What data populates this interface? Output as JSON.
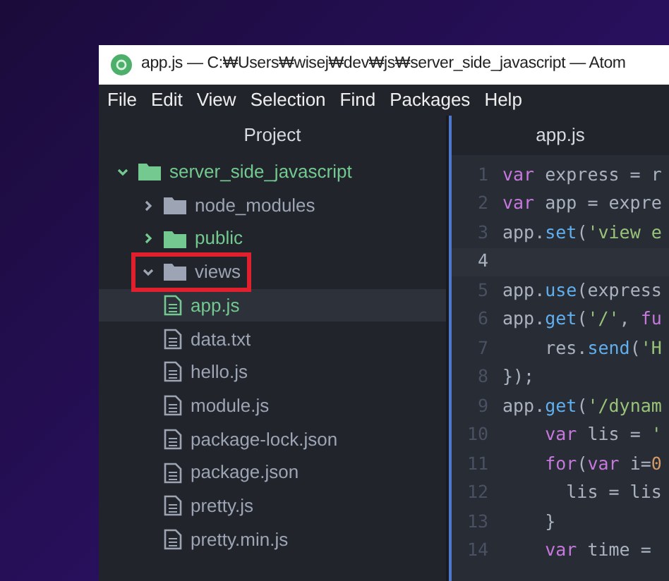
{
  "window": {
    "title": "app.js — C:₩Users₩wisej₩dev₩js₩server_side_javascript — Atom"
  },
  "menu": [
    "File",
    "Edit",
    "View",
    "Selection",
    "Find",
    "Packages",
    "Help"
  ],
  "tree_view": {
    "title": "Project",
    "items": [
      {
        "kind": "folder",
        "label": "server_side_javascript",
        "expanded": true,
        "color": "#73c990",
        "selected": false,
        "annotated": false,
        "children": [
          {
            "kind": "folder",
            "label": "node_modules",
            "expanded": false,
            "color": "#9da5b4",
            "selected": false,
            "annotated": false
          },
          {
            "kind": "folder",
            "label": "public",
            "expanded": false,
            "color": "#73c990",
            "selected": false,
            "annotated": false
          },
          {
            "kind": "folder",
            "label": "views",
            "expanded": true,
            "color": "#9da5b4",
            "selected": false,
            "annotated": true
          },
          {
            "kind": "file",
            "label": "app.js",
            "color": "#73c990",
            "selected": true,
            "annotated": false
          },
          {
            "kind": "file",
            "label": "data.txt",
            "color": "#9da5b4",
            "selected": false,
            "annotated": false
          },
          {
            "kind": "file",
            "label": "hello.js",
            "color": "#9da5b4",
            "selected": false,
            "annotated": false
          },
          {
            "kind": "file",
            "label": "module.js",
            "color": "#9da5b4",
            "selected": false,
            "annotated": false
          },
          {
            "kind": "file",
            "label": "package-lock.json",
            "color": "#9da5b4",
            "selected": false,
            "annotated": false
          },
          {
            "kind": "file",
            "label": "package.json",
            "color": "#9da5b4",
            "selected": false,
            "annotated": false
          },
          {
            "kind": "file",
            "label": "pretty.js",
            "color": "#9da5b4",
            "selected": false,
            "annotated": false
          },
          {
            "kind": "file",
            "label": "pretty.min.js",
            "color": "#9da5b4",
            "selected": false,
            "annotated": false
          }
        ]
      }
    ]
  },
  "editor": {
    "tab": "app.js",
    "lines": [
      {
        "number": "1",
        "current": false,
        "tokens": [
          {
            "kind": "keyword",
            "text": "var"
          },
          {
            "kind": "plain",
            "text": " express = r"
          }
        ]
      },
      {
        "number": "2",
        "current": false,
        "tokens": [
          {
            "kind": "keyword",
            "text": "var"
          },
          {
            "kind": "plain",
            "text": " app = expre"
          }
        ]
      },
      {
        "number": "3",
        "current": false,
        "tokens": [
          {
            "kind": "plain",
            "text": "app."
          },
          {
            "kind": "method",
            "text": "set"
          },
          {
            "kind": "plain",
            "text": "("
          },
          {
            "kind": "string",
            "text": "'view e"
          }
        ]
      },
      {
        "number": "4",
        "current": true
      },
      {
        "number": "5",
        "current": false,
        "tokens": [
          {
            "kind": "plain",
            "text": "app."
          },
          {
            "kind": "method",
            "text": "use"
          },
          {
            "kind": "plain",
            "text": "(express"
          }
        ]
      },
      {
        "number": "6",
        "current": false,
        "tokens": [
          {
            "kind": "plain",
            "text": "app."
          },
          {
            "kind": "method",
            "text": "get"
          },
          {
            "kind": "plain",
            "text": "("
          },
          {
            "kind": "string",
            "text": "'/'"
          },
          {
            "kind": "plain",
            "text": ", "
          },
          {
            "kind": "keyword",
            "text": "fu"
          }
        ]
      },
      {
        "number": "7",
        "current": false,
        "tokens": [
          {
            "kind": "plain",
            "text": "    res."
          },
          {
            "kind": "method",
            "text": "send"
          },
          {
            "kind": "plain",
            "text": "("
          },
          {
            "kind": "string",
            "text": "'H"
          }
        ]
      },
      {
        "number": "8",
        "current": false,
        "tokens": [
          {
            "kind": "plain",
            "text": "});"
          }
        ]
      },
      {
        "number": "9",
        "current": false,
        "tokens": [
          {
            "kind": "plain",
            "text": "app."
          },
          {
            "kind": "method",
            "text": "get"
          },
          {
            "kind": "plain",
            "text": "("
          },
          {
            "kind": "string",
            "text": "'/dynam"
          }
        ]
      },
      {
        "number": "10",
        "current": false,
        "tokens": [
          {
            "kind": "keyword",
            "text": "    var"
          },
          {
            "kind": "plain",
            "text": " lis = "
          },
          {
            "kind": "string",
            "text": "'"
          }
        ]
      },
      {
        "number": "11",
        "current": false,
        "tokens": [
          {
            "kind": "keyword",
            "text": "    for"
          },
          {
            "kind": "plain",
            "text": "("
          },
          {
            "kind": "keyword",
            "text": "var"
          },
          {
            "kind": "plain",
            "text": " i="
          },
          {
            "kind": "number",
            "text": "0"
          }
        ]
      },
      {
        "number": "12",
        "current": false,
        "tokens": [
          {
            "kind": "plain",
            "text": "      lis = lis"
          }
        ]
      },
      {
        "number": "13",
        "current": false,
        "tokens": [
          {
            "kind": "plain",
            "text": "    }"
          }
        ]
      },
      {
        "number": "14",
        "current": false,
        "tokens": [
          {
            "kind": "keyword",
            "text": "    var"
          },
          {
            "kind": "plain",
            "text": " time = "
          }
        ]
      }
    ]
  }
}
